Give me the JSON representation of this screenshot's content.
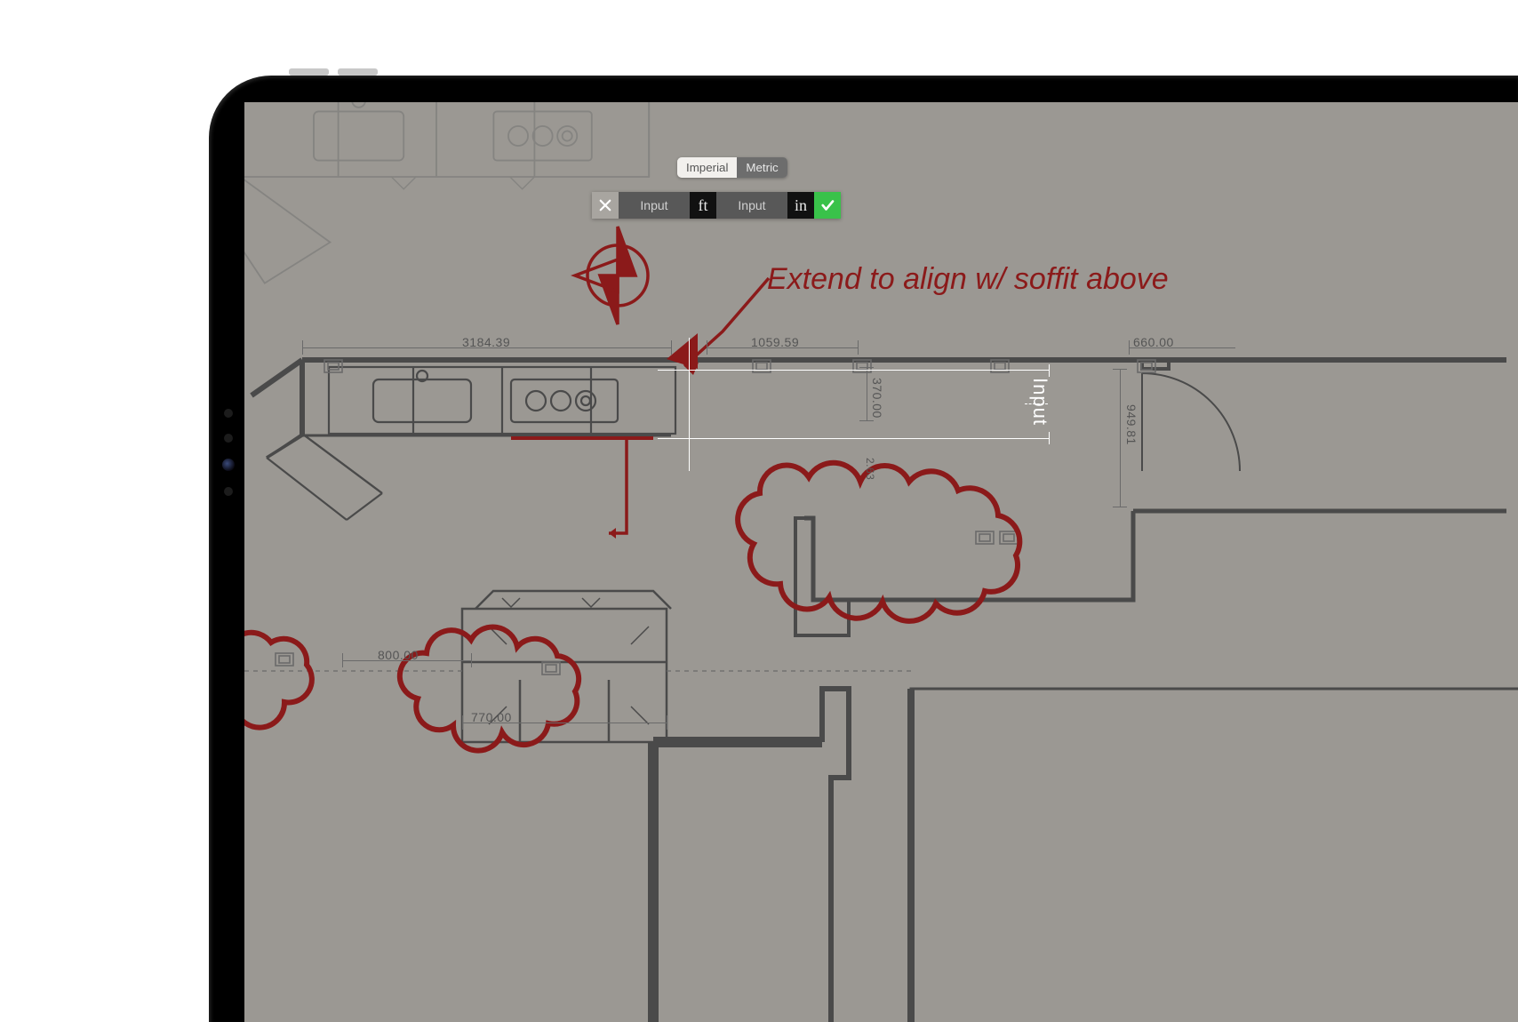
{
  "unit_toggle": {
    "imperial": "Imperial",
    "metric": "Metric",
    "active": "imperial"
  },
  "measure_bar": {
    "ft_placeholder": "Input",
    "ft_unit": "ft",
    "in_placeholder": "Input",
    "in_unit": "in"
  },
  "annotation_1": "Extend to align w/ soffit above",
  "dimensions": {
    "a": "3184.39",
    "b": "1059.59",
    "c": "660.00",
    "d": "370.00",
    "e": "949.81",
    "f": "800.00",
    "g": "770.00",
    "h": "2.63"
  },
  "measure_label": "Input",
  "colors": {
    "annotation": "#8b1a1a",
    "confirm": "#39c24a",
    "canvas_bg": "#9b9893"
  }
}
